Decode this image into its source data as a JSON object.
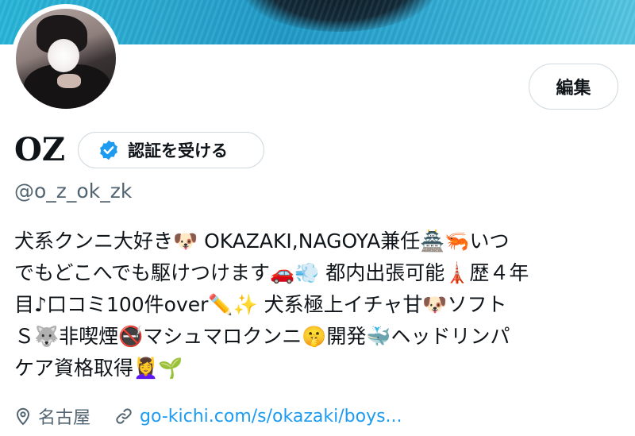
{
  "profile": {
    "name": "OZ",
    "handle": "@o_z_ok_zk",
    "edit_label": "編集",
    "verify_label": "認証を受ける",
    "bio_lines": [
      "犬系クンニ大好き🐶 OKAZAKI,NAGOYA兼任🏯🦐いつ",
      "でもどこへでも駆けつけます🚗💨 都内出張可能🗼歴４年",
      "目♪口コミ100件over✏️✨ 犬系極上イチャ甘🐶ソフト",
      "Ｓ🐺非喫煙🚭マシュマロクンニ🤫開発🐳ヘッドリンパ",
      "ケア資格取得💆‍♀️🌱"
    ],
    "location": "名古屋",
    "website": "go-kichi.com/s/okazaki/boys..."
  },
  "icons": {
    "verify": "verified-badge-icon",
    "location": "location-pin-icon",
    "link": "link-icon"
  },
  "colors": {
    "accent": "#1d9bf0",
    "secondary_text": "#536471",
    "border": "#cfd9de"
  }
}
